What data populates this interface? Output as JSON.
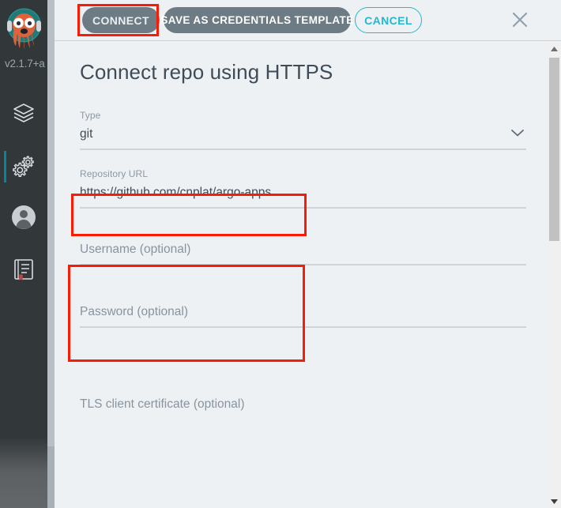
{
  "app": {
    "name": "Argo CD",
    "version": "v2.1.7+a",
    "logo_icon": "argo-octopus-logo"
  },
  "sidebar": {
    "items": [
      {
        "icon": "layers-icon",
        "name": "applications",
        "active": false
      },
      {
        "icon": "gears-icon",
        "name": "settings",
        "active": true
      },
      {
        "icon": "user-icon",
        "name": "user-info",
        "active": false
      },
      {
        "icon": "book-icon",
        "name": "documentation",
        "active": false
      }
    ]
  },
  "toolbar": {
    "connect_label": "CONNECT",
    "save_template_label": "SAVE AS CREDENTIALS TEMPLATE",
    "cancel_label": "CANCEL",
    "close_icon": "close-icon"
  },
  "form": {
    "title": "Connect repo using HTTPS",
    "fields": {
      "type": {
        "label": "Type",
        "value": "git",
        "chevron_icon": "chevron-down-icon"
      },
      "repository_url": {
        "label": "Repository URL",
        "value": "https://github.com/cnplat/argo-apps",
        "placeholder": "Repository URL"
      },
      "username": {
        "label": "Username (optional)",
        "value": "",
        "placeholder": "Username (optional)"
      },
      "password": {
        "label": "Password (optional)",
        "value": "",
        "placeholder": "Password (optional)"
      },
      "tls_client_certificate": {
        "label": "TLS client certificate (optional)",
        "value": "",
        "placeholder": "TLS client certificate (optional)"
      }
    }
  },
  "scrollbars": {
    "up_arrow_icon": "scroll-up-arrow-icon",
    "down_arrow_icon": "scroll-down-arrow-icon"
  },
  "annotations": {
    "accent_color": "#f81b06",
    "boxes": [
      {
        "name": "connect-button-highlight"
      },
      {
        "name": "repository-url-highlight"
      },
      {
        "name": "credentials-highlight"
      }
    ]
  },
  "colors": {
    "sidebar_bg": "#32373a",
    "panel_bg": "#eef1f4",
    "button_bg": "#6d7b84",
    "cancel_accent": "#22b8cf",
    "active_indicator": "#00899e",
    "annotation_red": "#f81b06"
  }
}
